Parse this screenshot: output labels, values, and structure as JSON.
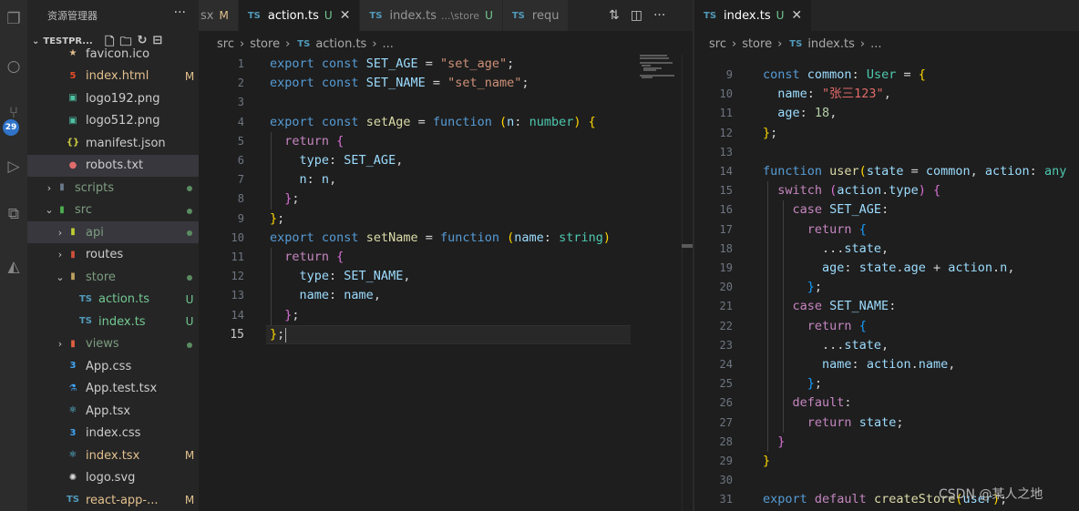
{
  "sidebar": {
    "title": "资源管理器",
    "more": "···",
    "project": "TESTPR...",
    "tree": [
      {
        "label": "favicon.ico",
        "icon": "★",
        "iconColor": "#e2c08d",
        "labelClass": "c-norm",
        "status": "",
        "indent": 2
      },
      {
        "label": "index.html",
        "icon": "5",
        "iconColor": "#e44d26",
        "labelClass": "c-mod",
        "status": "M",
        "indent": 2
      },
      {
        "label": "logo192.png",
        "icon": "▣",
        "iconColor": "#4ec2a3",
        "labelClass": "c-norm",
        "status": "",
        "indent": 2
      },
      {
        "label": "logo512.png",
        "icon": "▣",
        "iconColor": "#4ec2a3",
        "labelClass": "c-norm",
        "status": "",
        "indent": 2
      },
      {
        "label": "manifest.json",
        "icon": "{}",
        "iconColor": "#cbcb41",
        "labelClass": "c-norm",
        "status": "",
        "indent": 2
      },
      {
        "label": "robots.txt",
        "icon": "●",
        "iconColor": "#e06c6c",
        "labelClass": "c-norm",
        "status": "",
        "indent": 2,
        "selected": true
      },
      {
        "label": "scripts",
        "icon": "▮",
        "iconColor": "#6a7a8a",
        "labelClass": "c-dim",
        "status": "dot",
        "indent": 1,
        "twisty": "›"
      },
      {
        "label": "src",
        "icon": "▮",
        "iconColor": "#4caf50",
        "labelClass": "c-dim",
        "status": "dot",
        "indent": 1,
        "twisty": "⌄"
      },
      {
        "label": "api",
        "icon": "▮",
        "iconColor": "#c0ca33",
        "labelClass": "c-dim",
        "status": "dot",
        "indent": 2,
        "twisty": "›",
        "selected": true
      },
      {
        "label": "routes",
        "icon": "▮",
        "iconColor": "#d0513a",
        "labelClass": "c-norm",
        "status": "",
        "indent": 2,
        "twisty": "›"
      },
      {
        "label": "store",
        "icon": "▮",
        "iconColor": "#c0a060",
        "labelClass": "c-dim",
        "status": "dot",
        "indent": 2,
        "twisty": "⌄"
      },
      {
        "label": "action.ts",
        "icon": "TS",
        "iconColor": "#519aba",
        "labelClass": "c-untr",
        "status": "U",
        "indent": 3
      },
      {
        "label": "index.ts",
        "icon": "TS",
        "iconColor": "#519aba",
        "labelClass": "c-untr",
        "status": "U",
        "indent": 3
      },
      {
        "label": "views",
        "icon": "▮",
        "iconColor": "#e06040",
        "labelClass": "c-dim",
        "status": "dot",
        "indent": 2,
        "twisty": "›"
      },
      {
        "label": "App.css",
        "icon": "3",
        "iconColor": "#42a5f5",
        "labelClass": "c-norm",
        "status": "",
        "indent": 2
      },
      {
        "label": "App.test.tsx",
        "icon": "⚗",
        "iconColor": "#42a5f5",
        "labelClass": "c-norm",
        "status": "",
        "indent": 2
      },
      {
        "label": "App.tsx",
        "icon": "⚛",
        "iconColor": "#61dafb",
        "labelClass": "c-norm",
        "status": "",
        "indent": 2
      },
      {
        "label": "index.css",
        "icon": "3",
        "iconColor": "#42a5f5",
        "labelClass": "c-norm",
        "status": "",
        "indent": 2
      },
      {
        "label": "index.tsx",
        "icon": "⚛",
        "iconColor": "#61dafb",
        "labelClass": "c-mod",
        "status": "M",
        "indent": 2
      },
      {
        "label": "logo.svg",
        "icon": "✺",
        "iconColor": "#dddddd",
        "labelClass": "c-norm",
        "status": "",
        "indent": 2
      },
      {
        "label": "react-app-...",
        "icon": "TS",
        "iconColor": "#519aba",
        "labelClass": "c-mod",
        "status": "M",
        "indent": 2
      }
    ]
  },
  "activity_badge": "29",
  "tabs_left": [
    {
      "name": "sx",
      "status": "M",
      "active": false
    },
    {
      "name": "action.ts",
      "status": "U",
      "active": true,
      "close": "✕"
    },
    {
      "name": "index.ts",
      "sub": "...\\store",
      "status": "U",
      "active": false
    },
    {
      "name": "requ",
      "status": "",
      "active": false
    }
  ],
  "tabs_right": [
    {
      "name": "index.ts",
      "status": "U",
      "active": true,
      "close": "✕"
    }
  ],
  "crumbs_left": {
    "a": "src",
    "b": "store",
    "file": "action.ts",
    "tail": "..."
  },
  "crumbs_right": {
    "a": "src",
    "b": "store",
    "file": "index.ts",
    "tail": "..."
  },
  "left_editor": {
    "lines": [
      [
        [
          "k",
          "export "
        ],
        [
          "k",
          "const "
        ],
        [
          "v",
          "SET_AGE"
        ],
        [
          "p",
          " = "
        ],
        [
          "s",
          "\"set_age\""
        ],
        [
          "p",
          ";"
        ]
      ],
      [
        [
          "k",
          "export "
        ],
        [
          "k",
          "const "
        ],
        [
          "v",
          "SET_NAME"
        ],
        [
          "p",
          " = "
        ],
        [
          "s",
          "\"set_name\""
        ],
        [
          "p",
          ";"
        ]
      ],
      [],
      [
        [
          "k",
          "export "
        ],
        [
          "k",
          "const "
        ],
        [
          "f",
          "setAge"
        ],
        [
          "p",
          " = "
        ],
        [
          "k",
          "function "
        ],
        [
          "br1",
          "("
        ],
        [
          "v",
          "n"
        ],
        [
          "p",
          ": "
        ],
        [
          "t",
          "number"
        ],
        [
          "br1",
          ")"
        ],
        [
          "p",
          " "
        ],
        [
          "br1",
          "{"
        ]
      ],
      [
        [
          "p",
          "  "
        ],
        [
          "kc",
          "return "
        ],
        [
          "br2",
          "{"
        ]
      ],
      [
        [
          "p",
          "    "
        ],
        [
          "v",
          "type"
        ],
        [
          "p",
          ": "
        ],
        [
          "v",
          "SET_AGE"
        ],
        [
          "p",
          ","
        ]
      ],
      [
        [
          "p",
          "    "
        ],
        [
          "v",
          "n"
        ],
        [
          "p",
          ": "
        ],
        [
          "v",
          "n"
        ],
        [
          "p",
          ","
        ]
      ],
      [
        [
          "p",
          "  "
        ],
        [
          "br2",
          "}"
        ],
        [
          "p",
          ";"
        ]
      ],
      [
        [
          "br1",
          "}"
        ],
        [
          "p",
          ";"
        ]
      ],
      [
        [
          "k",
          "export "
        ],
        [
          "k",
          "const "
        ],
        [
          "f",
          "setName"
        ],
        [
          "p",
          " = "
        ],
        [
          "k",
          "function "
        ],
        [
          "br1",
          "("
        ],
        [
          "v",
          "name"
        ],
        [
          "p",
          ": "
        ],
        [
          "t",
          "string"
        ],
        [
          "br1",
          ")"
        ]
      ],
      [
        [
          "p",
          "  "
        ],
        [
          "kc",
          "return "
        ],
        [
          "br2",
          "{"
        ]
      ],
      [
        [
          "p",
          "    "
        ],
        [
          "v",
          "type"
        ],
        [
          "p",
          ": "
        ],
        [
          "v",
          "SET_NAME"
        ],
        [
          "p",
          ","
        ]
      ],
      [
        [
          "p",
          "    "
        ],
        [
          "v",
          "name"
        ],
        [
          "p",
          ": "
        ],
        [
          "v",
          "name"
        ],
        [
          "p",
          ","
        ]
      ],
      [
        [
          "p",
          "  "
        ],
        [
          "br2",
          "}"
        ],
        [
          "p",
          ";"
        ]
      ],
      [
        [
          "br1",
          "}"
        ],
        [
          "p",
          ";"
        ]
      ]
    ],
    "line_numbers": [
      "1",
      "2",
      "3",
      "4",
      "5",
      "6",
      "7",
      "8",
      "9",
      "10",
      "11",
      "12",
      "13",
      "14",
      "15"
    ],
    "current_line": 15
  },
  "right_editor": {
    "line_numbers": [
      "9",
      "10",
      "11",
      "12",
      "13",
      "14",
      "15",
      "16",
      "17",
      "18",
      "19",
      "20",
      "21",
      "22",
      "23",
      "24",
      "25",
      "26",
      "27",
      "28",
      "29",
      "30",
      "31"
    ],
    "lines": [
      [
        [
          "k",
          "const "
        ],
        [
          "v",
          "common"
        ],
        [
          "p",
          ": "
        ],
        [
          "t",
          "User"
        ],
        [
          "p",
          " = "
        ],
        [
          "br1",
          "{"
        ]
      ],
      [
        [
          "p",
          "  "
        ],
        [
          "v",
          "name"
        ],
        [
          "p",
          ": "
        ],
        [
          "s2",
          "\"张三123\""
        ],
        [
          "p",
          ","
        ]
      ],
      [
        [
          "p",
          "  "
        ],
        [
          "v",
          "age"
        ],
        [
          "p",
          ": "
        ],
        [
          "n",
          "18"
        ],
        [
          "p",
          ","
        ]
      ],
      [
        [
          "br1",
          "}"
        ],
        [
          "p",
          ";"
        ]
      ],
      [],
      [
        [
          "k",
          "function "
        ],
        [
          "f",
          "user"
        ],
        [
          "br1",
          "("
        ],
        [
          "v",
          "state"
        ],
        [
          "p",
          " = "
        ],
        [
          "v",
          "common"
        ],
        [
          "p",
          ", "
        ],
        [
          "v",
          "action"
        ],
        [
          "p",
          ": "
        ],
        [
          "t",
          "any"
        ]
      ],
      [
        [
          "p",
          "  "
        ],
        [
          "kc",
          "switch "
        ],
        [
          "br2",
          "("
        ],
        [
          "v",
          "action"
        ],
        [
          "p",
          "."
        ],
        [
          "v",
          "type"
        ],
        [
          "br2",
          ")"
        ],
        [
          "p",
          " "
        ],
        [
          "br2",
          "{"
        ]
      ],
      [
        [
          "p",
          "    "
        ],
        [
          "kc",
          "case "
        ],
        [
          "v",
          "SET_AGE"
        ],
        [
          "p",
          ":"
        ]
      ],
      [
        [
          "p",
          "      "
        ],
        [
          "kc",
          "return "
        ],
        [
          "br3",
          "{"
        ]
      ],
      [
        [
          "p",
          "        ..."
        ],
        [
          "v",
          "state"
        ],
        [
          "p",
          ","
        ]
      ],
      [
        [
          "p",
          "        "
        ],
        [
          "v",
          "age"
        ],
        [
          "p",
          ": "
        ],
        [
          "v",
          "state"
        ],
        [
          "p",
          "."
        ],
        [
          "v",
          "age"
        ],
        [
          "p",
          " + "
        ],
        [
          "v",
          "action"
        ],
        [
          "p",
          "."
        ],
        [
          "v",
          "n"
        ],
        [
          "p",
          ","
        ]
      ],
      [
        [
          "p",
          "      "
        ],
        [
          "br3",
          "}"
        ],
        [
          "p",
          ";"
        ]
      ],
      [
        [
          "p",
          "    "
        ],
        [
          "kc",
          "case "
        ],
        [
          "v",
          "SET_NAME"
        ],
        [
          "p",
          ":"
        ]
      ],
      [
        [
          "p",
          "      "
        ],
        [
          "kc",
          "return "
        ],
        [
          "br3",
          "{"
        ]
      ],
      [
        [
          "p",
          "        ..."
        ],
        [
          "v",
          "state"
        ],
        [
          "p",
          ","
        ]
      ],
      [
        [
          "p",
          "        "
        ],
        [
          "v",
          "name"
        ],
        [
          "p",
          ": "
        ],
        [
          "v",
          "action"
        ],
        [
          "p",
          "."
        ],
        [
          "v",
          "name"
        ],
        [
          "p",
          ","
        ]
      ],
      [
        [
          "p",
          "      "
        ],
        [
          "br3",
          "}"
        ],
        [
          "p",
          ";"
        ]
      ],
      [
        [
          "p",
          "    "
        ],
        [
          "kc",
          "default"
        ],
        [
          "p",
          ":"
        ]
      ],
      [
        [
          "p",
          "      "
        ],
        [
          "kc",
          "return "
        ],
        [
          "v",
          "state"
        ],
        [
          "p",
          ";"
        ]
      ],
      [
        [
          "p",
          "  "
        ],
        [
          "br2",
          "}"
        ]
      ],
      [
        [
          "br1",
          "}"
        ]
      ],
      [],
      [
        [
          "k",
          "export "
        ],
        [
          "kc",
          "default "
        ],
        [
          "f",
          "createStore"
        ],
        [
          "br1",
          "("
        ],
        [
          "v",
          "user"
        ],
        [
          "br1",
          ")"
        ],
        [
          "p",
          ";"
        ]
      ]
    ]
  },
  "watermark": "CSDN @某人之地"
}
